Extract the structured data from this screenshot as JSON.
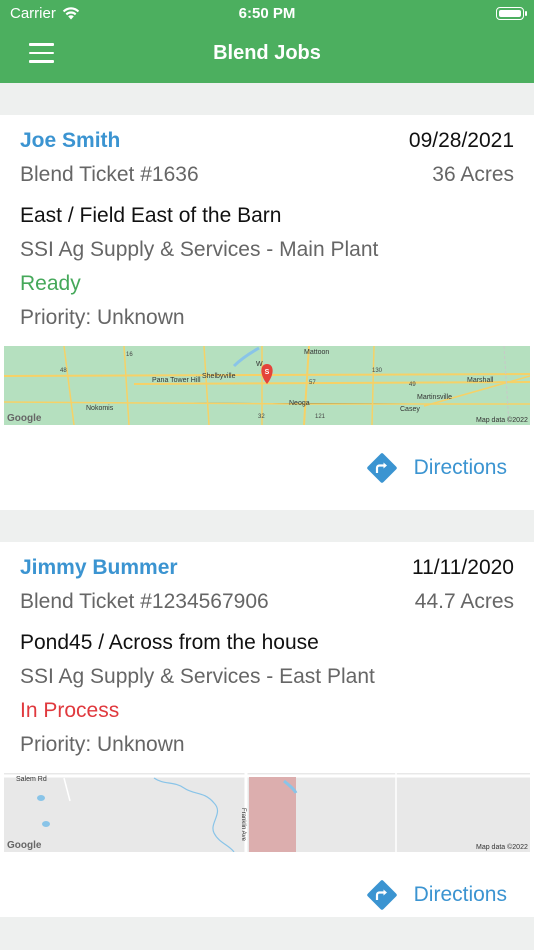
{
  "status_bar": {
    "carrier": "Carrier",
    "time": "6:50 PM"
  },
  "nav": {
    "title": "Blend Jobs"
  },
  "jobs": [
    {
      "customer": "Joe Smith",
      "date": "09/28/2021",
      "ticket": "Blend Ticket #1636",
      "acres": "36 Acres",
      "field": "East / Field East of the Barn",
      "plant": "SSI Ag Supply & Services - Main Plant",
      "status": "Ready",
      "priority": "Priority: Unknown",
      "map_labels": {
        "town1": "Pana Tower Hill",
        "town2": "Shelbyville",
        "town3": "Mattoon",
        "town4": "Nokomis",
        "town5": "Neoga",
        "town6": "Martinsville",
        "town7": "Marshall",
        "town8": "Casey",
        "town9": "W",
        "route1": "48",
        "route2": "16",
        "route3": "49",
        "route4": "130",
        "route5": "121",
        "route6": "32",
        "route7": "57",
        "google": "Google",
        "credit": "Map data ©2022",
        "pin": "S"
      },
      "directions": "Directions"
    },
    {
      "customer": "Jimmy Bummer",
      "date": "11/11/2020",
      "ticket": "Blend Ticket #1234567906",
      "acres": "44.7 Acres",
      "field": "Pond45 / Across from the house",
      "plant": "SSI Ag Supply & Services - East Plant",
      "status": "In Process",
      "priority": "Priority: Unknown",
      "map_labels": {
        "road1": "Salem Rd",
        "road2": "Franklin Ave",
        "google": "Google",
        "credit": "Map data ©2022"
      },
      "directions": "Directions"
    }
  ],
  "colors": {
    "header": "#4caf5f",
    "link": "#3b94d1",
    "ready": "#45a85a",
    "in_process": "#e0393e"
  }
}
